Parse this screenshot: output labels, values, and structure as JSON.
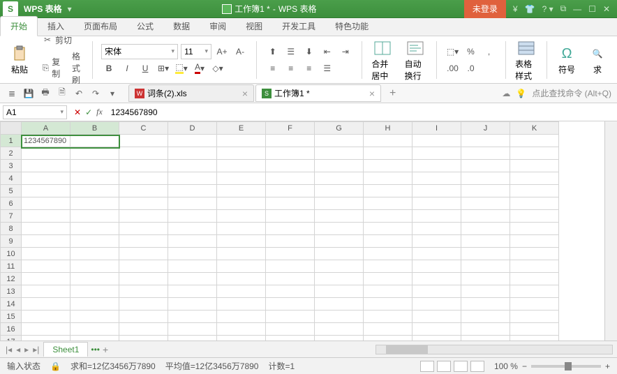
{
  "app": {
    "name": "WPS 表格",
    "logo": "S"
  },
  "title": {
    "doc": "工作簿1 *",
    "suffix": "WPS 表格"
  },
  "login": "未登录",
  "menu": {
    "tabs": [
      "开始",
      "插入",
      "页面布局",
      "公式",
      "数据",
      "审阅",
      "视图",
      "开发工具",
      "特色功能"
    ],
    "active": 0
  },
  "ribbon": {
    "paste": "粘贴",
    "cut": "剪切",
    "copy": "复制",
    "formatPainter": "格式刷",
    "font": "宋体",
    "fontSize": "11",
    "merge": "合并居中",
    "wrap": "自动换行",
    "tableStyle": "表格样式",
    "symbol": "符号",
    "find": "求"
  },
  "qat": {
    "hint": "点此查找命令 (Alt+Q)"
  },
  "docTabs": [
    {
      "icon": "w",
      "label": "词条(2).xls",
      "active": false
    },
    {
      "icon": "s",
      "label": "工作簿1 *",
      "active": true
    }
  ],
  "formula": {
    "cellRef": "A1",
    "value": "1234567890"
  },
  "columns": [
    "A",
    "B",
    "C",
    "D",
    "E",
    "F",
    "G",
    "H",
    "I",
    "J",
    "K"
  ],
  "rows": 17,
  "selectedCols": [
    0,
    1
  ],
  "selectedRow": 0,
  "cells": {
    "A1": "1234567890"
  },
  "sheet": {
    "name": "Sheet1"
  },
  "status": {
    "mode": "输入状态",
    "sum": "求和=12亿3456万7890",
    "avg": "平均值=12亿3456万7890",
    "count": "计数=1",
    "zoom": "100 %"
  }
}
